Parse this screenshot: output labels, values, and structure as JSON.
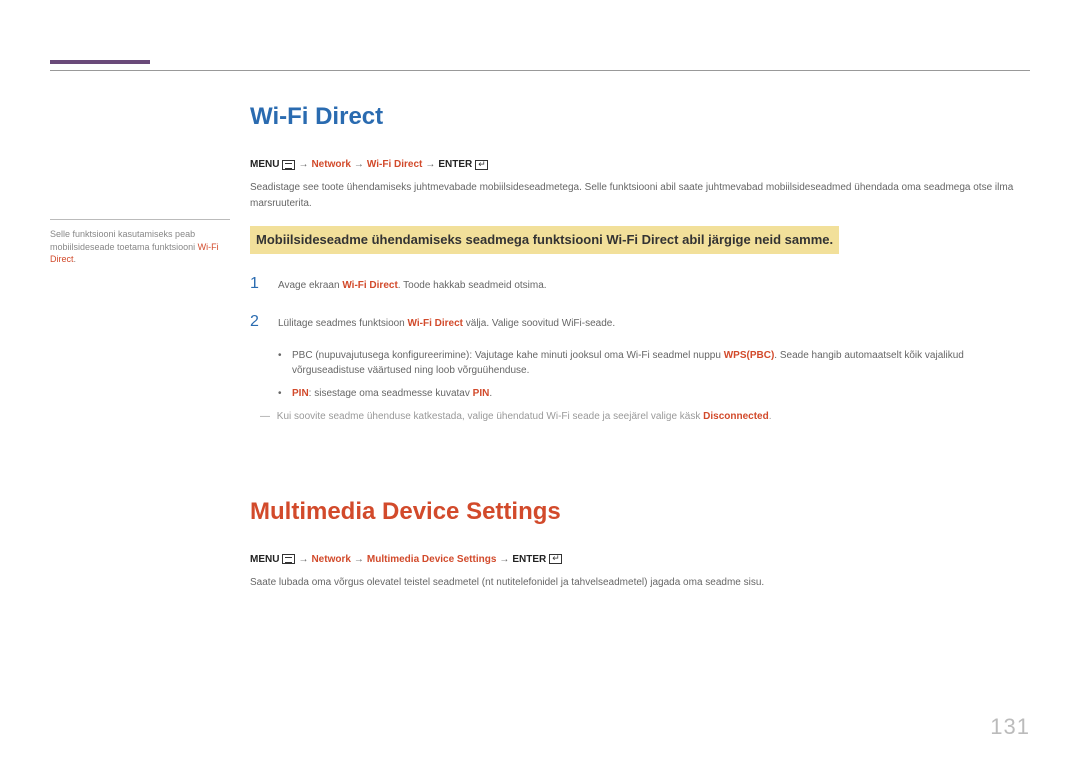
{
  "sidebar": {
    "note_pre": "Selle funktsiooni kasutamiseks peab mobiilsideseade toetama funktsiooni ",
    "note_red": "Wi-Fi Direct",
    "note_post": "."
  },
  "section1": {
    "title": "Wi-Fi Direct",
    "path": {
      "menu": "MENU",
      "network": "Network",
      "item": "Wi-Fi Direct",
      "enter": "ENTER"
    },
    "intro": "Seadistage see toote ühendamiseks juhtmevabade mobiilsideseadmetega. Selle funktsiooni abil saate juhtmevabad mobiilsideseadmed ühendada oma seadmega otse ilma marsruuterita.",
    "highlight": "Mobiilsideseadme ühendamiseks seadmega funktsiooni Wi-Fi Direct abil järgige neid samme.",
    "step1_pre": "Avage ekraan ",
    "step1_red": "Wi-Fi Direct",
    "step1_post": ". Toode hakkab seadmeid otsima.",
    "step2_pre": "Lülitage seadmes funktsioon ",
    "step2_red": "Wi-Fi Direct",
    "step2_post": " välja. Valige soovitud WiFi-seade.",
    "bullet1_pre": "PBC (nupuvajutusega konfigureerimine): Vajutage kahe minuti jooksul oma Wi-Fi seadmel nuppu ",
    "bullet1_red": "WPS(PBC)",
    "bullet1_post": ". Seade hangib automaatselt kõik vajalikud võrguseadistuse väärtused ning loob võrguühenduse.",
    "bullet2_red1": "PIN",
    "bullet2_mid": ": sisestage oma seadmesse kuvatav ",
    "bullet2_red2": "PIN",
    "bullet2_post": ".",
    "note_pre": "Kui soovite seadme ühenduse katkestada, valige ühendatud Wi-Fi seade ja seejärel valige käsk ",
    "note_red": "Disconnected",
    "note_post": "."
  },
  "section2": {
    "title": "Multimedia Device Settings",
    "path": {
      "menu": "MENU",
      "network": "Network",
      "item": "Multimedia Device Settings",
      "enter": "ENTER"
    },
    "intro": "Saate lubada oma võrgus olevatel teistel seadmetel (nt nutitelefonidel ja tahvelseadmetel) jagada oma seadme sisu."
  },
  "page_number": "131"
}
